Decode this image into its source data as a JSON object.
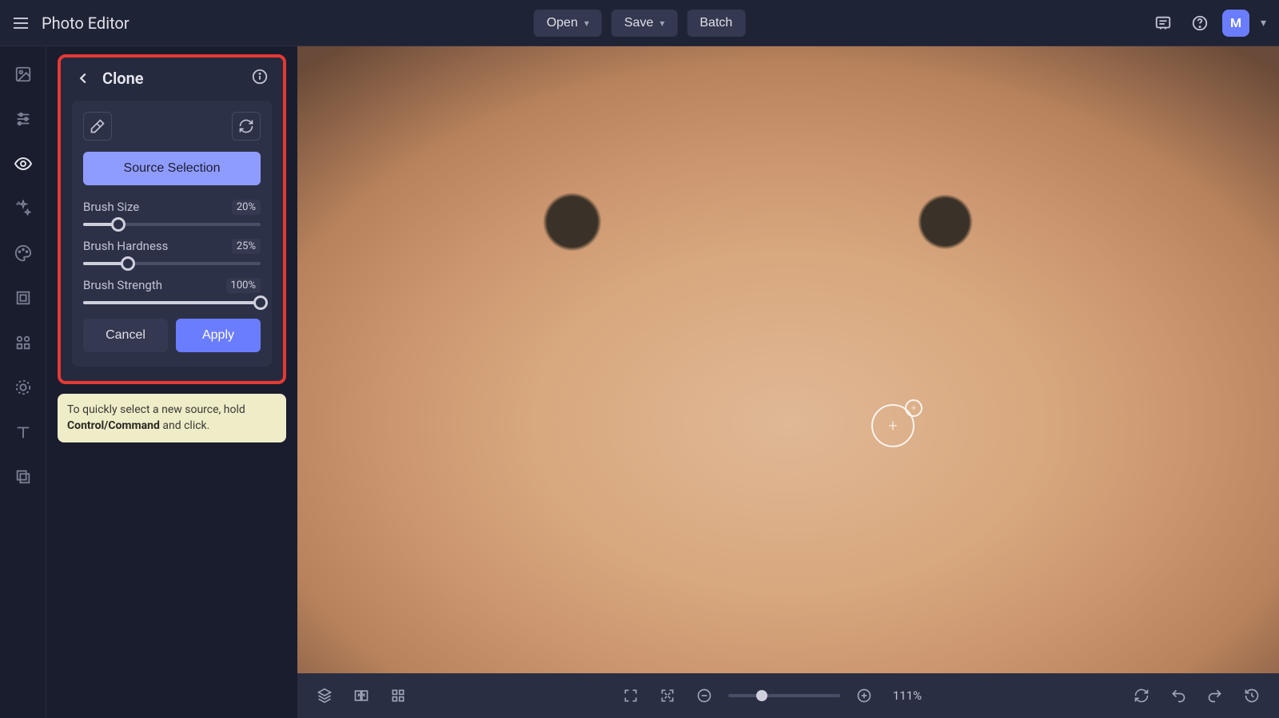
{
  "app": {
    "title": "Photo Editor"
  },
  "topbar": {
    "open": "Open",
    "save": "Save",
    "batch": "Batch",
    "avatar_initial": "M"
  },
  "panel": {
    "title": "Clone",
    "source_selection": "Source Selection",
    "brush_size_label": "Brush Size",
    "brush_size_value": "20%",
    "brush_size_pct": 20,
    "brush_hardness_label": "Brush Hardness",
    "brush_hardness_value": "25%",
    "brush_hardness_pct": 25,
    "brush_strength_label": "Brush Strength",
    "brush_strength_value": "100%",
    "brush_strength_pct": 100,
    "cancel": "Cancel",
    "apply": "Apply"
  },
  "hint": {
    "pre": "To quickly select a new source, hold ",
    "bold": "Control/Command",
    "post": " and click."
  },
  "bottom": {
    "zoom_label": "111%",
    "zoom_pct": 30
  }
}
